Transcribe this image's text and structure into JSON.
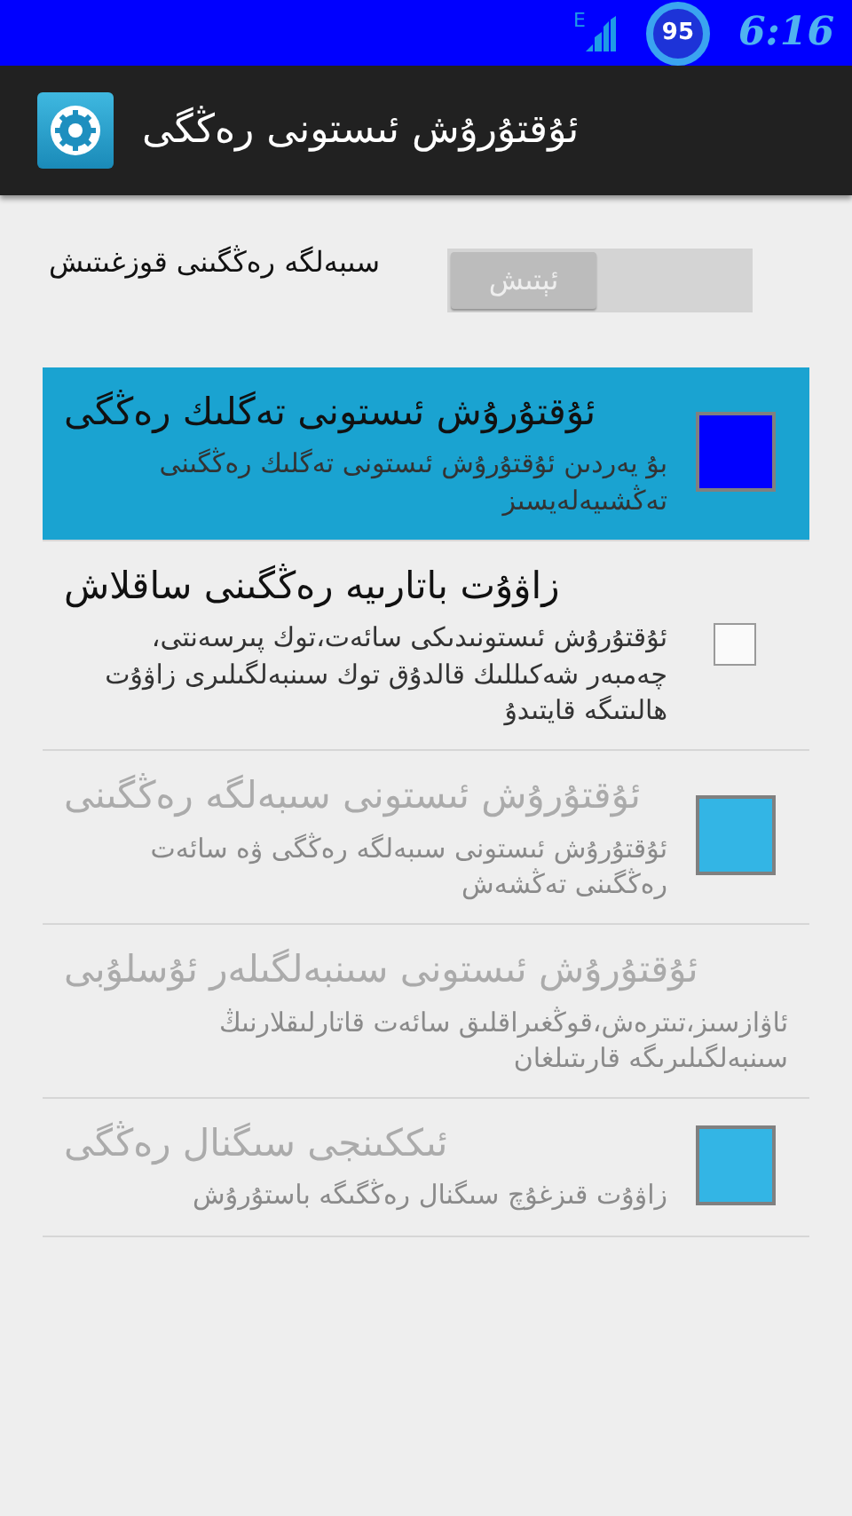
{
  "status_bar": {
    "network": "E",
    "battery": "95",
    "time": "6:16"
  },
  "action_bar": {
    "title": "ئۇقتۇرۇش ئىستونى رەڭگى"
  },
  "enable_row": {
    "label": "سىبەلگە رەڭگىنى قوزغىتىش",
    "toggle": {
      "label": "ئېتىش",
      "on": false
    }
  },
  "preferences": [
    {
      "kind": "color",
      "title": "ئۇقتۇرۇش ئىستونى تەگلىك رەڭگى",
      "summary": "بۇ يەردىن ئۇقتۇرۇش ئىستونى تەگلىك رەڭگىنى تەڭشىيەلەيسىز",
      "selected": true,
      "disabled": false,
      "color": "#0000ff"
    },
    {
      "kind": "checkbox",
      "title": "زاۋۇت باتارىيە رەڭگىنى ساقلاش",
      "summary": "ئۇقتۇرۇش ئىستونىدىكى سائەت،توك پىرسەنتى، چەمبەر شەكىللىك قالدۇق توك سىنبەلگىلىرى زاۋۇت ھالىتىگە قايتىدۇ",
      "selected": false,
      "disabled": false,
      "checked": false
    },
    {
      "kind": "color",
      "title": "ئۇقتۇرۇش ئىستونى سىبەلگە رەڭگىنى",
      "summary": "ئۇقتۇرۇش ئىستونى سىبەلگە رەڭگى ۋە سائەت رەڭگىنى تەڭشەش",
      "selected": false,
      "disabled": true,
      "color": "#33b5e5"
    },
    {
      "kind": "plain",
      "title": "ئۇقتۇرۇش ئىستونى سىنبەلگىلەر ئۇسلۇبى",
      "summary": "ئاۋازسىز،تىترەش،قوڭغىراقلىق سائەت قاتارلىقلارنىڭ سىنبەلگىلىرىگە قارىتىلغان",
      "selected": false,
      "disabled": true
    },
    {
      "kind": "color",
      "title": "ئىككىنجى سىگنال رەڭگى",
      "summary": "زاۋۇت قىزغۇچ سىگنال رەڭگىگە باستۇرۇش",
      "selected": false,
      "disabled": true,
      "color": "#33b5e5"
    }
  ]
}
